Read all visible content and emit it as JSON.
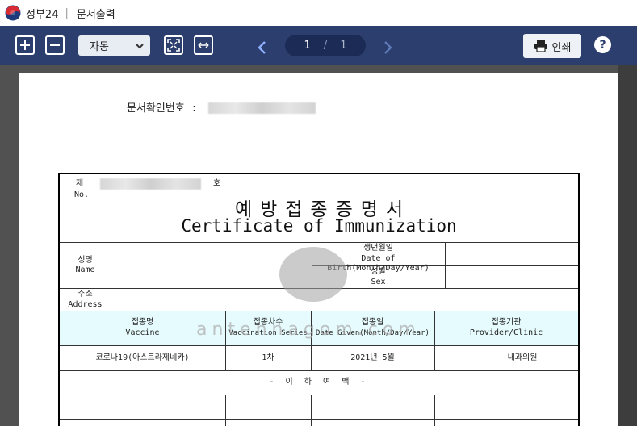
{
  "titlebar": {
    "app_name": "정부24",
    "separator": "|",
    "window_title": "문서출력"
  },
  "toolbar": {
    "zoom_value": "자동",
    "page_current": "1",
    "page_separator": "/",
    "page_total": "1",
    "print_label": "인쇄",
    "help_label": "?"
  },
  "document": {
    "confirm_label": "문서확인번호 :",
    "cert": {
      "no_label_ko": "제",
      "no_label_en": "No.",
      "no_suffix": "호",
      "title_ko": "예방접종증명서",
      "title_en": "Certificate of Immunization",
      "name_ko": "성명",
      "name_en": "Name",
      "dob_ko": "생년월일",
      "dob_en": "Date of Birth(Month/Day/Year)",
      "sex_ko": "성별",
      "sex_en": "Sex",
      "address_ko": "주소",
      "address_en": "Address",
      "vaccine_ko": "접종명",
      "vaccine_en": "Vaccine",
      "series_ko": "접종차수",
      "series_en": "Vaccination Series",
      "date_ko": "접종일",
      "date_en": "Date Given(Month/Day/Year)",
      "provider_ko": "접종기관",
      "provider_en": "Provider/Clinic",
      "row1": {
        "vaccine": "코로나19(아스트라제네카)",
        "series": "1차",
        "date": "2021년  5월",
        "provider": "내과의원"
      },
      "blank_note": "-  이  하  여  백  -"
    },
    "watermark": "antennagom.com"
  },
  "colors": {
    "toolbar": "#2c3e6e",
    "viewer_bg": "#515151",
    "vaccine_header_bg": "#e6fbfd"
  }
}
